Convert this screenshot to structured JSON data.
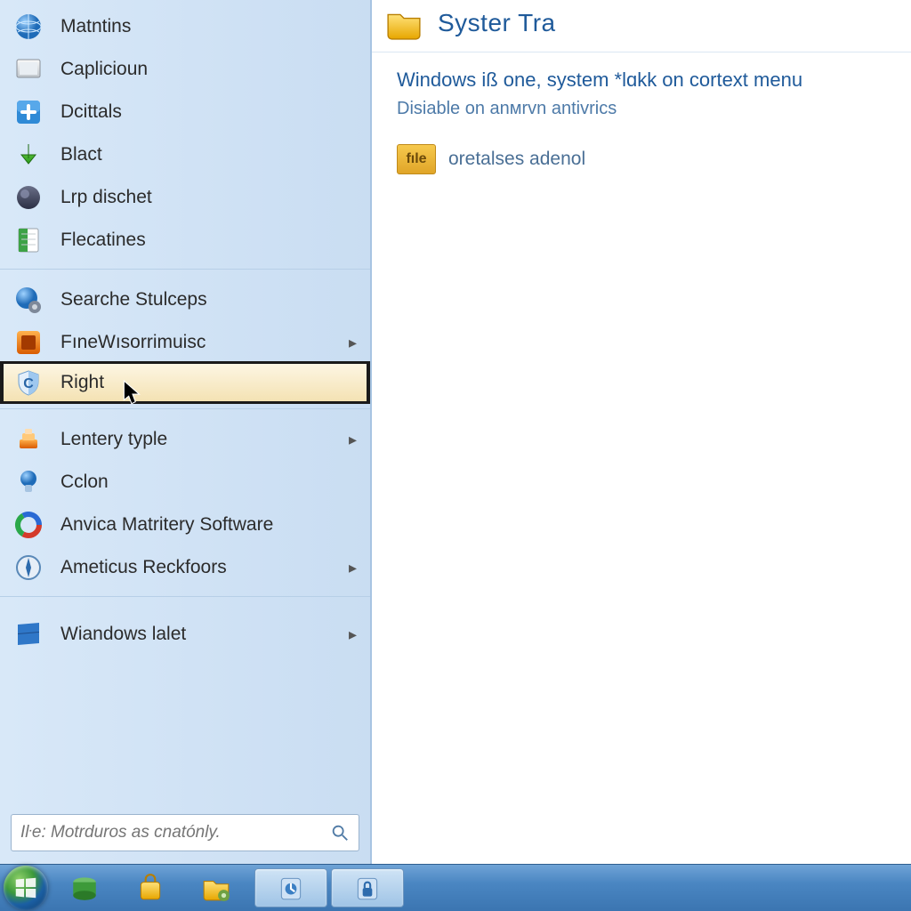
{
  "start_menu": {
    "group_a": [
      {
        "label": "Matntins",
        "icon": "globe-blue"
      },
      {
        "label": "Caplicioun",
        "icon": "screen-gray"
      },
      {
        "label": "Dcittals",
        "icon": "plus-blue"
      },
      {
        "label": "Blact",
        "icon": "arrow-down-green"
      },
      {
        "label": "Lrp dischet",
        "icon": "orb-dark"
      },
      {
        "label": "Flecatines",
        "icon": "sheet-green"
      }
    ],
    "group_b": [
      {
        "label": "Searche Stulceps",
        "icon": "globe-gear",
        "submenu": false
      },
      {
        "label": "FıneWısorrimuisc",
        "icon": "tile-orange",
        "submenu": true
      },
      {
        "label": "Right",
        "icon": "shield-c",
        "submenu": false,
        "selected": true
      }
    ],
    "group_c": [
      {
        "label": "Lentery typle",
        "icon": "stack-orange",
        "submenu": true
      },
      {
        "label": "Cclon",
        "icon": "bulb-blue",
        "submenu": false
      },
      {
        "label": "Anvica Matritery Software",
        "icon": "ring-rgb",
        "submenu": false
      },
      {
        "label": "Ameticus Reckfoors",
        "icon": "compass-blue",
        "submenu": true
      }
    ],
    "group_d": [
      {
        "label": "Wiandows lalet",
        "icon": "flag-win",
        "submenu": true
      }
    ],
    "search_placeholder": "Iŀe: Мotrduros as cnatónly."
  },
  "content": {
    "title": "Syster Tra",
    "line1": "Windows iß one, system *lɑkk on cortext menu",
    "line2": "Disiable on anᴍrvn antivrics",
    "file_badge": "fıle",
    "file_label": "oretalses adenol"
  },
  "taskbar": {
    "pinned": [
      "drive-green",
      "bag-yellow",
      "folder-gear"
    ],
    "open": [
      "bucket-blue",
      "lock-blue"
    ]
  }
}
